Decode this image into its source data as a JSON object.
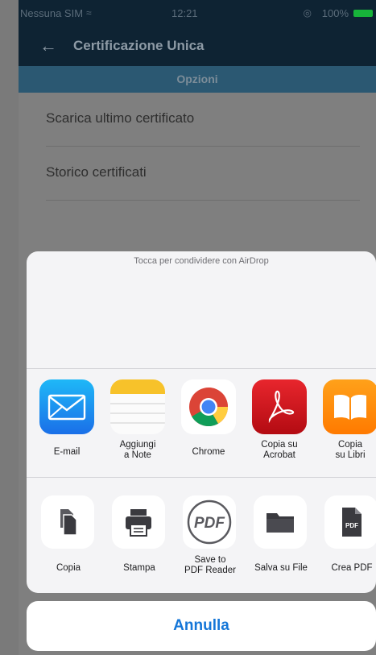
{
  "status_bar": {
    "carrier": "Nessuna SIM",
    "time": "12:21",
    "battery": "100%"
  },
  "nav": {
    "title": "Certificazione Unica"
  },
  "options_bar": {
    "label": "Opzioni"
  },
  "list": [
    {
      "label": "Scarica ultimo certificato"
    },
    {
      "label": "Storico certificati"
    }
  ],
  "share_sheet": {
    "airdrop_hint": "Tocca per condividere con AirDrop",
    "apps": [
      {
        "label": "E-mail",
        "icon": "mail-icon"
      },
      {
        "label": "Aggiungi\na Note",
        "icon": "notes-icon"
      },
      {
        "label": "Chrome",
        "icon": "chrome-icon"
      },
      {
        "label": "Copia su\nAcrobat",
        "icon": "acrobat-icon"
      },
      {
        "label": "Copia\nsu Libri",
        "icon": "books-icon"
      }
    ],
    "actions": [
      {
        "label": "Copia",
        "icon": "copy-icon"
      },
      {
        "label": "Stampa",
        "icon": "print-icon"
      },
      {
        "label": "Save to\nPDF Reader",
        "icon": "pdf-reader-icon",
        "badge": "PDF"
      },
      {
        "label": "Salva su File",
        "icon": "folder-icon"
      },
      {
        "label": "Crea PDF",
        "icon": "create-pdf-icon",
        "badge": "PDF"
      }
    ],
    "cancel_label": "Annulla"
  },
  "colors": {
    "nav_bg": "#0e2333",
    "options_bg": "#2b5872",
    "accent": "#1476d8",
    "battery": "#17b33a",
    "sheet_bg": "#f4f4f6"
  }
}
